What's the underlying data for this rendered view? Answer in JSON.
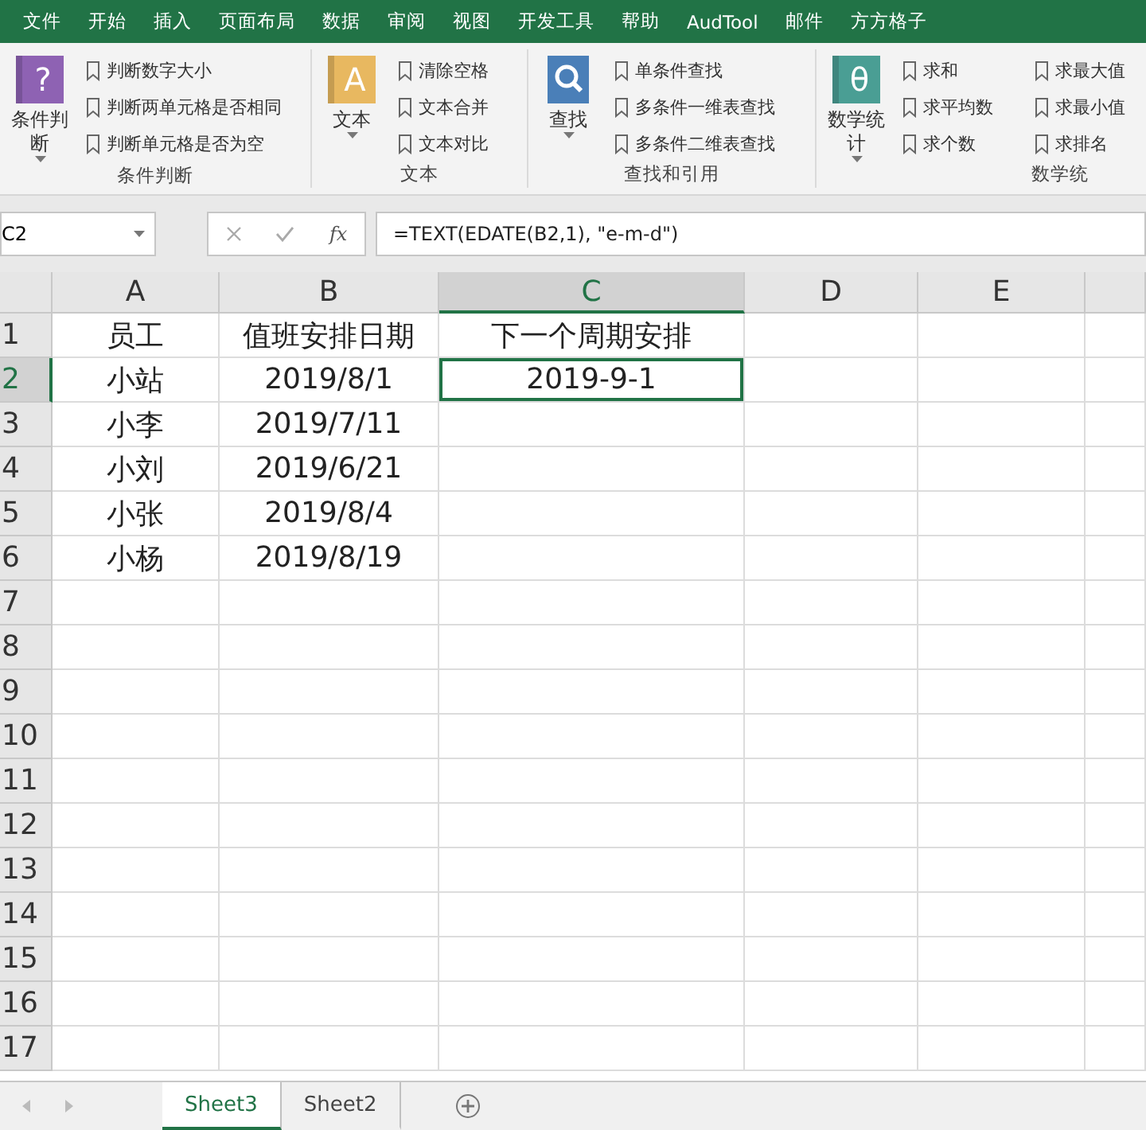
{
  "menu_tabs": [
    "文件",
    "开始",
    "插入",
    "页面布局",
    "数据",
    "审阅",
    "视图",
    "开发工具",
    "帮助",
    "AudTool",
    "邮件",
    "方方格子"
  ],
  "ribbon_groups": [
    {
      "label": "条件判断",
      "button": {
        "label": "条件判断",
        "glyph": "?",
        "kind": "book",
        "color": "#8e62b3"
      },
      "items": [
        "判断数字大小",
        "判断两单元格是否相同",
        "判断单元格是否为空"
      ]
    },
    {
      "label": "文本",
      "button": {
        "label": "文本",
        "glyph": "A",
        "kind": "book",
        "color": "#e8b860"
      },
      "items": [
        "清除空格",
        "文本合并",
        "文本对比"
      ]
    },
    {
      "label": "查找和引用",
      "button": {
        "label": "查找",
        "kind": "search",
        "color": "#4a7fb8"
      },
      "items": [
        "单条件查找",
        "多条件一维表查找",
        "多条件二维表查找"
      ]
    },
    {
      "button": {
        "label": "数学统计",
        "glyph": "θ",
        "kind": "book",
        "color": "#4a9e94"
      },
      "items": [
        "求和",
        "求平均数",
        "求个数"
      ]
    },
    {
      "label": "数学统",
      "items": [
        "求最大值",
        "求最小值",
        "求排名"
      ]
    }
  ],
  "name_box": "C2",
  "function_label": "fx",
  "formula": "=TEXT(EDATE(B2,1), \"e-m-d\")",
  "columns": [
    {
      "label": "A",
      "selected": false
    },
    {
      "label": "B",
      "selected": false
    },
    {
      "label": "C",
      "selected": true
    },
    {
      "label": "D",
      "selected": false
    },
    {
      "label": "E",
      "selected": false
    }
  ],
  "rows": [
    {
      "header": "1",
      "selected": false,
      "cells": [
        {
          "text": "员工",
          "selected": false
        },
        {
          "text": "值班安排日期",
          "selected": false
        },
        {
          "text": "下一个周期安排",
          "selected": false
        }
      ]
    },
    {
      "header": "2",
      "selected": true,
      "cells": [
        {
          "text": "小站",
          "selected": false
        },
        {
          "text": "2019/8/1",
          "selected": false
        },
        {
          "text": "2019-9-1",
          "selected": true
        }
      ]
    },
    {
      "header": "3",
      "selected": false,
      "cells": [
        {
          "text": "小李",
          "selected": false
        },
        {
          "text": "2019/7/11",
          "selected": false
        }
      ]
    },
    {
      "header": "4",
      "selected": false,
      "cells": [
        {
          "text": "小刘",
          "selected": false
        },
        {
          "text": "2019/6/21",
          "selected": false
        }
      ]
    },
    {
      "header": "5",
      "selected": false,
      "cells": [
        {
          "text": "小张",
          "selected": false
        },
        {
          "text": "2019/8/4",
          "selected": false
        }
      ]
    },
    {
      "header": "6",
      "selected": false,
      "cells": [
        {
          "text": "小杨",
          "selected": false
        },
        {
          "text": "2019/8/19",
          "selected": false
        }
      ]
    },
    {
      "header": "7",
      "selected": false,
      "cells": []
    },
    {
      "header": "8",
      "selected": false,
      "cells": []
    },
    {
      "header": "9",
      "selected": false,
      "cells": []
    },
    {
      "header": "10",
      "selected": false,
      "cells": []
    },
    {
      "header": "11",
      "selected": false,
      "cells": []
    },
    {
      "header": "12",
      "selected": false,
      "cells": []
    },
    {
      "header": "13",
      "selected": false,
      "cells": []
    },
    {
      "header": "14",
      "selected": false,
      "cells": []
    },
    {
      "header": "15",
      "selected": false,
      "cells": []
    },
    {
      "header": "16",
      "selected": false,
      "cells": []
    },
    {
      "header": "17",
      "selected": false,
      "cells": []
    }
  ],
  "sheet_tabs": [
    {
      "label": "Sheet3",
      "selected": true
    },
    {
      "label": "Sheet2",
      "selected": false
    }
  ]
}
